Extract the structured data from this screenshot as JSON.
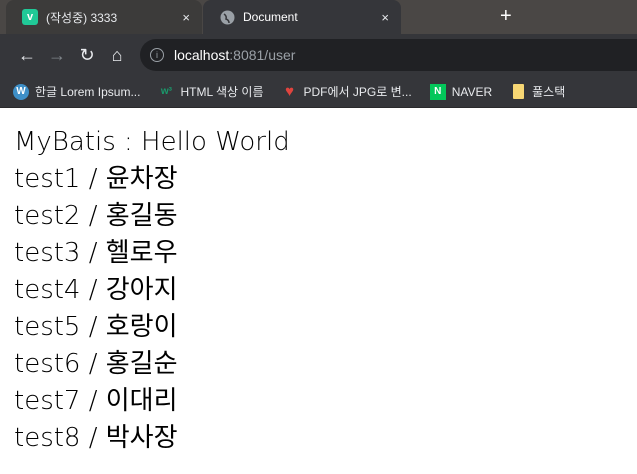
{
  "tabs": [
    {
      "title": "(작성중) 3333",
      "icon": "v"
    },
    {
      "title": "Document",
      "icon": "globe"
    }
  ],
  "close": "×",
  "newtab": "+",
  "nav": {
    "back": "←",
    "forward": "→",
    "reload": "↻",
    "home": "⌂"
  },
  "url": {
    "host": "localhost",
    "path": ":8081/user",
    "info": "i"
  },
  "bookmarks": [
    {
      "label": "한글 Lorem Ipsum...",
      "icon": "W",
      "color": "#3e8fc7"
    },
    {
      "label": "HTML 색상 이름",
      "icon": "w³",
      "color": "#1a9a6c"
    },
    {
      "label": "PDF에서 JPG로 변...",
      "icon": "♥",
      "color": "#e0443e"
    },
    {
      "label": "NAVER",
      "icon": "N",
      "color": "#03c75a"
    },
    {
      "label": "풀스택",
      "icon": "folder",
      "color": "#f7d774"
    }
  ],
  "content": {
    "title": "MyBatis : Hello World",
    "rows": [
      "test1 / 윤차장",
      "test2 / 홍길동",
      "test3 / 헬로우",
      "test4 / 강아지",
      "test5 / 호랑이",
      "test6 / 홍길순",
      "test7 / 이대리",
      "test8 / 박사장"
    ]
  }
}
